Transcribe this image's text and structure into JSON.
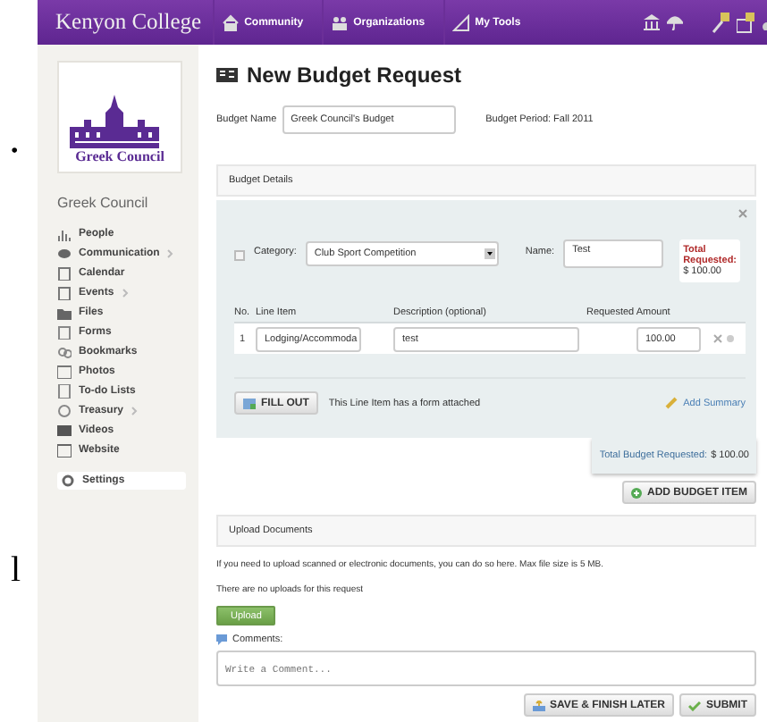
{
  "page_fragment": {
    "bullet": "•",
    "letter": "l"
  },
  "topbar": {
    "brand": "Kenyon College",
    "nav": [
      {
        "label": "Community"
      },
      {
        "label": "Organizations"
      },
      {
        "label": "My Tools"
      }
    ]
  },
  "sidebar": {
    "logo_text": "Greek Council",
    "org_name": "Greek Council",
    "items": [
      {
        "label": "People",
        "submenu": false
      },
      {
        "label": "Communication",
        "submenu": true
      },
      {
        "label": "Calendar",
        "submenu": false
      },
      {
        "label": "Events",
        "submenu": true
      },
      {
        "label": "Files",
        "submenu": false
      },
      {
        "label": "Forms",
        "submenu": false
      },
      {
        "label": "Bookmarks",
        "submenu": false
      },
      {
        "label": "Photos",
        "submenu": false
      },
      {
        "label": "To-do Lists",
        "submenu": false
      },
      {
        "label": "Treasury",
        "submenu": true
      },
      {
        "label": "Videos",
        "submenu": false
      },
      {
        "label": "Website",
        "submenu": false
      }
    ],
    "settings": {
      "label": "Settings",
      "selected": true
    }
  },
  "main": {
    "title": "New Budget Request",
    "budget_name_label": "Budget Name",
    "budget_name": "Greek Council's Budget",
    "budget_period": "Budget Period: Fall 2011",
    "details": {
      "header": "Budget Details",
      "category_label": "Category:",
      "category": "Club Sport Competition",
      "name_label": "Name:",
      "name": "Test",
      "total_label": "Total Requested:",
      "total": "$ 100.00",
      "columns": [
        "No.",
        "Line Item",
        "Description (optional)",
        "Requested Amount"
      ],
      "rows": [
        {
          "no": "1",
          "line_item": "Lodging/Accommoda",
          "description": "test",
          "amount": "100.00"
        }
      ],
      "fill_out": "FILL OUT",
      "form_note": "This Line Item has a form attached",
      "add_summary": "Add Summary"
    },
    "total_budget_label": "Total Budget Requested:",
    "total_budget": "$ 100.00",
    "add_item": "ADD BUDGET ITEM",
    "upload": {
      "header": "Upload Documents",
      "info": "If you need to upload scanned or electronic documents, you can do so here. Max file size is 5 MB.",
      "empty": "There are no uploads for this request",
      "button": "Upload",
      "comments_label": "Comments:",
      "comment_placeholder": "Write a Comment..."
    },
    "buttons": [
      {
        "label": "SAVE & FINISH LATER",
        "kind": "save"
      },
      {
        "label": "SUBMIT",
        "kind": "submit"
      }
    ]
  }
}
